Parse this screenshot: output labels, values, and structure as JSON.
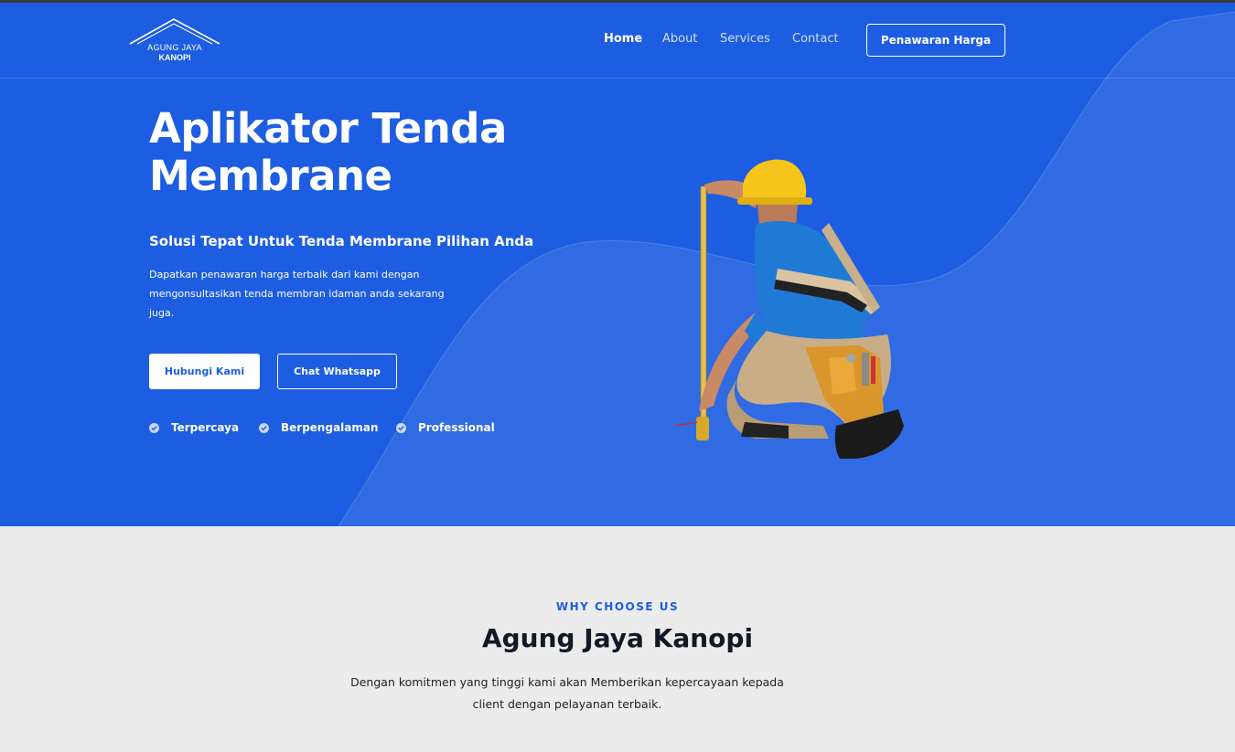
{
  "brand": {
    "line1": "AGUNG JAYA",
    "line2": "KANOPI"
  },
  "nav": {
    "items": [
      {
        "label": "Home",
        "active": true
      },
      {
        "label": "About",
        "active": false
      },
      {
        "label": "Services",
        "active": false
      },
      {
        "label": "Contact",
        "active": false
      }
    ],
    "cta_label": "Penawaran Harga"
  },
  "hero": {
    "title_line1": "Aplikator Tenda",
    "title_line2": "Membrane",
    "subtitle": "Solusi Tepat Untuk Tenda Membrane Pilihan Anda",
    "description": "Dapatkan penawaran harga terbaik dari kami dengan mengonsultasikan tenda membran idaman anda sekarang juga.",
    "primary_button": "Hubungi Kami",
    "secondary_button": "Chat Whatsapp",
    "features": [
      "Terpercaya",
      "Berpengalaman",
      "Professional"
    ],
    "image_icon": "worker-measuring-illustration"
  },
  "why": {
    "label": "WHY CHOOSE US",
    "title": "Agung Jaya Kanopi",
    "description": "Dengan komitmen yang tinggi kami akan Memberikan kepercayaan kepada client dengan pelayanan terbaik."
  },
  "colors": {
    "primary": "#1d5de1",
    "white": "#ffffff",
    "section_bg": "#ececec",
    "heading_dark": "#111827"
  }
}
